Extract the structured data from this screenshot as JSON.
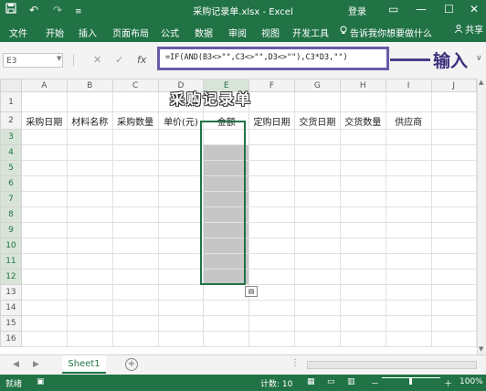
{
  "window": {
    "title": "采购记录单.xlsx - Excel",
    "login": "登录",
    "save_icon": "save-icon",
    "undo_glyph": "↶",
    "redo_glyph": "↷",
    "more_glyph": "≡",
    "restore_glyph": "▭",
    "minimize_glyph": "—",
    "maximize_glyph": "☐",
    "close_glyph": "✕"
  },
  "ribbon": {
    "tabs": [
      "文件",
      "开始",
      "插入",
      "页面布局",
      "公式",
      "数据",
      "审阅",
      "视图",
      "开发工具"
    ],
    "tell_me": "告诉我你想要做什么",
    "share": "共享"
  },
  "formula_bar": {
    "name_box": "E3",
    "cancel": "✕",
    "enter": "✓",
    "fx": "fx",
    "formula": "=IF(AND(B3<>\"\",C3<>\"\",D3<>\"\"),C3*D3,\"\")",
    "annotation": "输入"
  },
  "sheet": {
    "columns": [
      "A",
      "B",
      "C",
      "D",
      "E",
      "F",
      "G",
      "H",
      "I",
      "J"
    ],
    "rows": [
      "1",
      "2",
      "3",
      "4",
      "5",
      "6",
      "7",
      "8",
      "9",
      "10",
      "11",
      "12",
      "13",
      "14",
      "15",
      "16"
    ],
    "title": "采购记录单",
    "headers": [
      "采购日期",
      "材料名称",
      "采购数量",
      "单价(元)",
      "金额",
      "定购日期",
      "交货日期",
      "交货数量",
      "供应商"
    ],
    "selected_column": "E",
    "selected_range": "E3:E12"
  },
  "tabs": {
    "sheet1": "Sheet1",
    "add": "+"
  },
  "status": {
    "mode": "就绪",
    "count": "计数: 10",
    "zoom": "100%",
    "zoom_out": "－",
    "zoom_in": "＋"
  },
  "colors": {
    "excel_green": "#217346",
    "annotation_purple": "#3b2f7a",
    "selection_gray": "#c6c6c6"
  }
}
